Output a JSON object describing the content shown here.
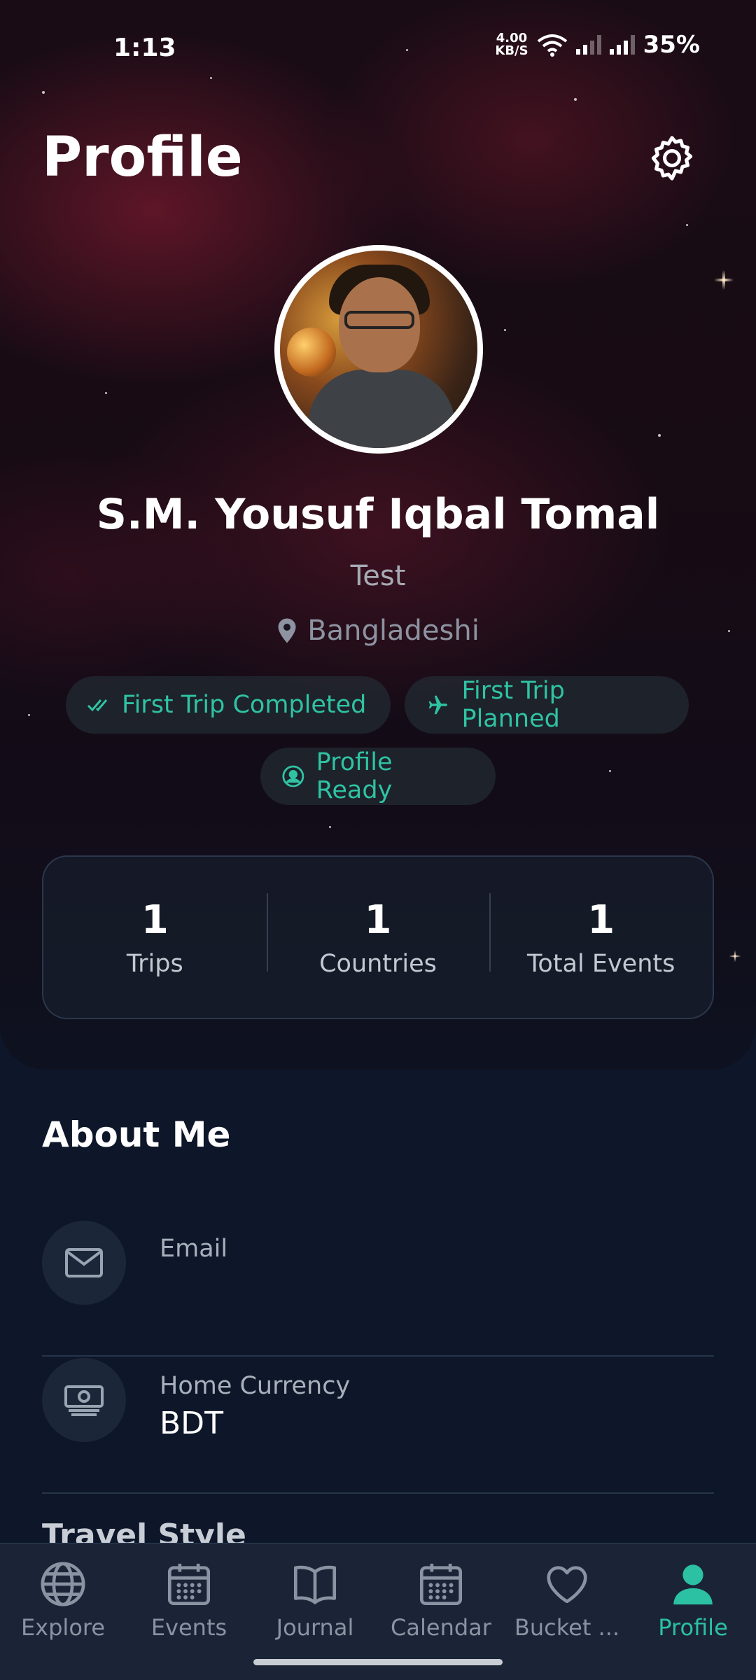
{
  "status_bar": {
    "time": "1:13",
    "net_speed_value": "4.00",
    "net_speed_unit": "KB/S",
    "battery": "35%"
  },
  "header": {
    "title": "Profile",
    "settings_icon": "gear-icon"
  },
  "profile": {
    "name": "S.M. Yousuf Iqbal Tomal",
    "subtitle": "Test",
    "location": "Bangladeshi",
    "location_icon": "map-pin-icon"
  },
  "badges": [
    {
      "label": "First Trip Completed",
      "icon": "double-check-icon"
    },
    {
      "label": "First Trip Planned",
      "icon": "airplane-icon"
    },
    {
      "label": "Profile Ready",
      "icon": "user-circle-icon"
    }
  ],
  "stats": [
    {
      "value": "1",
      "label": "Trips"
    },
    {
      "value": "1",
      "label": "Countries"
    },
    {
      "value": "1",
      "label": "Total Events"
    }
  ],
  "about": {
    "title": "About Me",
    "rows": [
      {
        "label": "Email",
        "value": "",
        "icon": "mail-icon"
      },
      {
        "label": "Home Currency",
        "value": "BDT",
        "icon": "banknote-icon"
      }
    ],
    "next_section": "Travel Style"
  },
  "bottom_nav": {
    "items": [
      {
        "label": "Explore",
        "icon": "globe-icon",
        "active": false
      },
      {
        "label": "Events",
        "icon": "calendar-grid-icon",
        "active": false
      },
      {
        "label": "Journal",
        "icon": "book-open-icon",
        "active": false
      },
      {
        "label": "Calendar",
        "icon": "calendar-icon",
        "active": false
      },
      {
        "label": "Bucket ...",
        "icon": "heart-icon",
        "active": false
      },
      {
        "label": "Profile",
        "icon": "person-icon",
        "active": true
      }
    ]
  },
  "colors": {
    "accent": "#2cc1a2",
    "background": "#0d1729",
    "inactive_nav": "#8a93a2"
  }
}
